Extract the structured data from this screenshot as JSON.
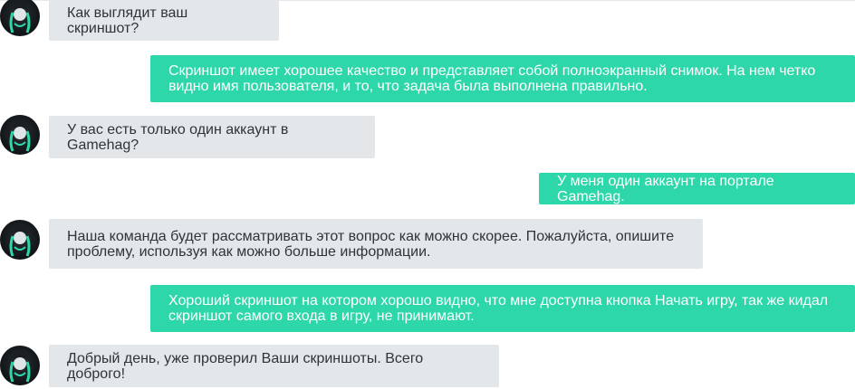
{
  "chat": {
    "messages": [
      {
        "from": "support",
        "text": "Как выглядит ваш скриншот?"
      },
      {
        "from": "user",
        "text": "Скриншот имеет хорошее качество и представляет собой полноэкранный снимок. На нем четко видно имя пользователя, и то, что задача была выполнена правильно."
      },
      {
        "from": "support",
        "text": "У вас есть только один аккаунт в Gamehag?"
      },
      {
        "from": "user",
        "text": "У меня один аккаунт на портале Gamehag."
      },
      {
        "from": "support",
        "text": "Наша команда будет рассматривать этот вопрос как можно скорее. Пожалуйста, опишите проблему, используя как можно больше информации."
      },
      {
        "from": "user",
        "text": "Хороший скриншот на котором хорошо видно, что мне доступна кнопка Начать игру, так же кидал скриншот самого входа в игру, не принимают."
      },
      {
        "from": "support",
        "text": "Добрый день, уже проверил Ваши скриншоты. Всего доброго!"
      }
    ]
  },
  "colors": {
    "support_bubble": "#e4e7ea",
    "user_bubble": "#2dd7a9",
    "support_text": "#2f3438",
    "user_text": "#ffffff",
    "avatar_accent": "#2dd7a9"
  },
  "icons": {
    "support_avatar": "avatar-icon"
  }
}
